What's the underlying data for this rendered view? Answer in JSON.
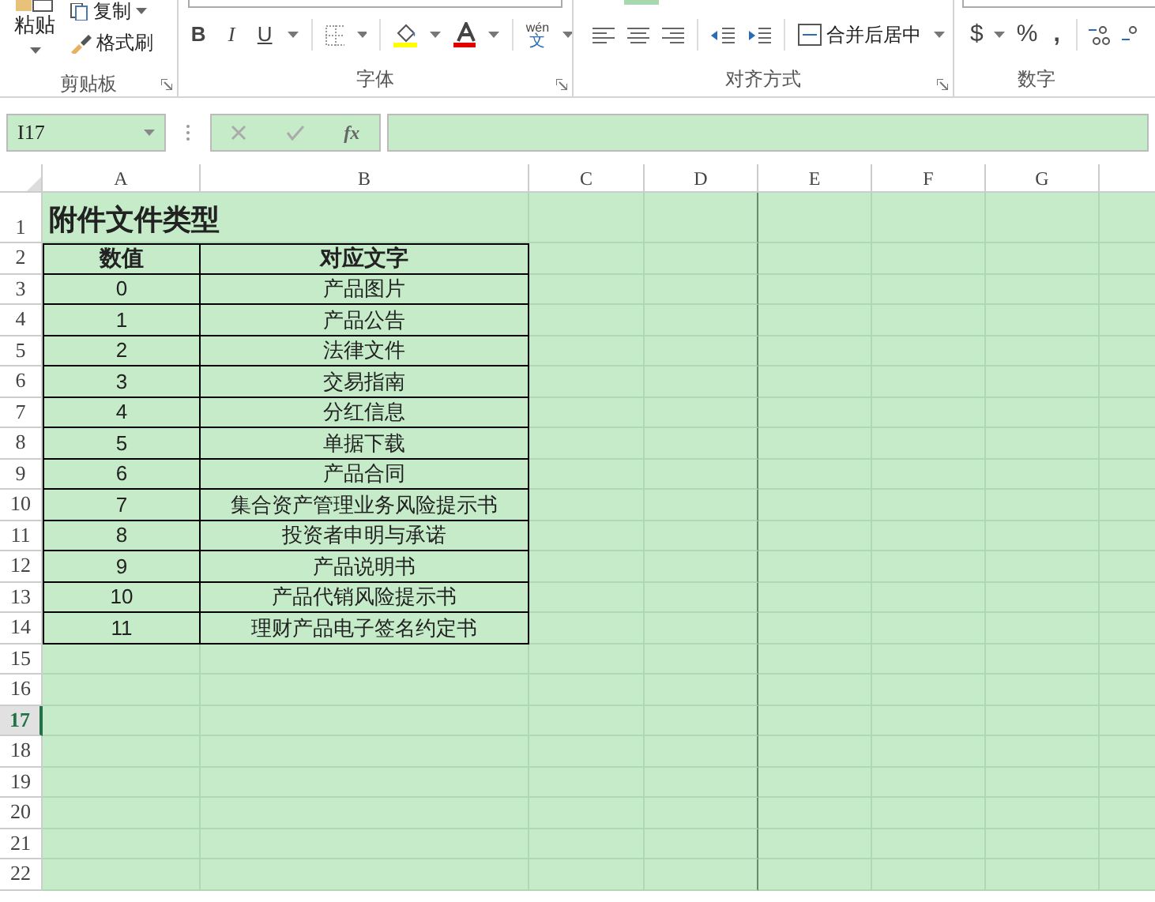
{
  "ribbon": {
    "clipboard": {
      "paste": "粘贴",
      "copy": "复制",
      "format_painter": "格式刷",
      "label": "剪贴板"
    },
    "font": {
      "bold": "B",
      "italic": "I",
      "underline": "U",
      "phonetic_top": "wén",
      "phonetic_bottom": "文",
      "label": "字体"
    },
    "alignment": {
      "merge": "合并后居中",
      "label": "对齐方式"
    },
    "number": {
      "currency": "$",
      "percent": "%",
      "comma": ",",
      "label": "数字"
    }
  },
  "formula_bar": {
    "name_box": "I17",
    "fx": "fx"
  },
  "sheet": {
    "columns": [
      "A",
      "B",
      "C",
      "D",
      "E",
      "F",
      "G"
    ],
    "rows": [
      {
        "number": "1",
        "selected": false,
        "kind": "title",
        "cells": [
          "附件文件类型"
        ]
      },
      {
        "number": "2",
        "selected": false,
        "kind": "header",
        "cells": [
          "数值",
          "对应文字"
        ]
      },
      {
        "number": "3",
        "selected": false,
        "kind": "data",
        "cells": [
          "0",
          "产品图片"
        ]
      },
      {
        "number": "4",
        "selected": false,
        "kind": "data",
        "cells": [
          "1",
          "产品公告"
        ]
      },
      {
        "number": "5",
        "selected": false,
        "kind": "data",
        "cells": [
          "2",
          "法律文件"
        ]
      },
      {
        "number": "6",
        "selected": false,
        "kind": "data",
        "cells": [
          "3",
          "交易指南"
        ]
      },
      {
        "number": "7",
        "selected": false,
        "kind": "data",
        "cells": [
          "4",
          "分红信息"
        ]
      },
      {
        "number": "8",
        "selected": false,
        "kind": "data",
        "cells": [
          "5",
          "单据下载"
        ]
      },
      {
        "number": "9",
        "selected": false,
        "kind": "data",
        "cells": [
          "6",
          "产品合同"
        ]
      },
      {
        "number": "10",
        "selected": false,
        "kind": "data",
        "cells": [
          "7",
          "集合资产管理业务风险提示书"
        ]
      },
      {
        "number": "11",
        "selected": false,
        "kind": "data",
        "cells": [
          "8",
          "投资者申明与承诺"
        ]
      },
      {
        "number": "12",
        "selected": false,
        "kind": "data",
        "cells": [
          "9",
          "产品说明书"
        ]
      },
      {
        "number": "13",
        "selected": false,
        "kind": "data",
        "cells": [
          "10",
          "产品代销风险提示书"
        ]
      },
      {
        "number": "14",
        "selected": false,
        "kind": "data",
        "cells": [
          "11",
          "理财产品电子签名约定书"
        ]
      },
      {
        "number": "15",
        "selected": false,
        "kind": "empty"
      },
      {
        "number": "16",
        "selected": false,
        "kind": "empty"
      },
      {
        "number": "17",
        "selected": true,
        "kind": "empty"
      },
      {
        "number": "18",
        "selected": false,
        "kind": "empty"
      },
      {
        "number": "19",
        "selected": false,
        "kind": "empty"
      },
      {
        "number": "20",
        "selected": false,
        "kind": "empty"
      },
      {
        "number": "21",
        "selected": false,
        "kind": "empty"
      },
      {
        "number": "22",
        "selected": false,
        "kind": "empty"
      }
    ]
  }
}
